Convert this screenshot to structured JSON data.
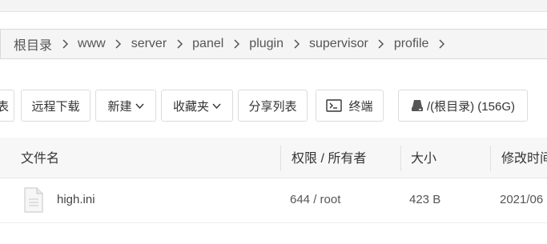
{
  "breadcrumb": {
    "items": [
      "根目录",
      "www",
      "server",
      "panel",
      "plugin",
      "supervisor",
      "profile"
    ]
  },
  "toolbar": {
    "partial_label": "表",
    "remote_download": "远程下载",
    "new": "新建",
    "favorites": "收藏夹",
    "share_list": "分享列表",
    "terminal": "终端",
    "disk": "/(根目录) (156G)"
  },
  "table": {
    "headers": {
      "name": "文件名",
      "permission": "权限 / 所有者",
      "size": "大小",
      "modified": "修改时间"
    },
    "rows": [
      {
        "name": "high.ini",
        "permission": "644 / root",
        "size": "423 B",
        "modified": "2021/06"
      }
    ]
  },
  "icons": {
    "chevron": "chevron-right-icon",
    "caret": "chevron-down-icon",
    "terminal": "terminal-icon",
    "disk": "disk-icon",
    "file": "file-icon"
  }
}
